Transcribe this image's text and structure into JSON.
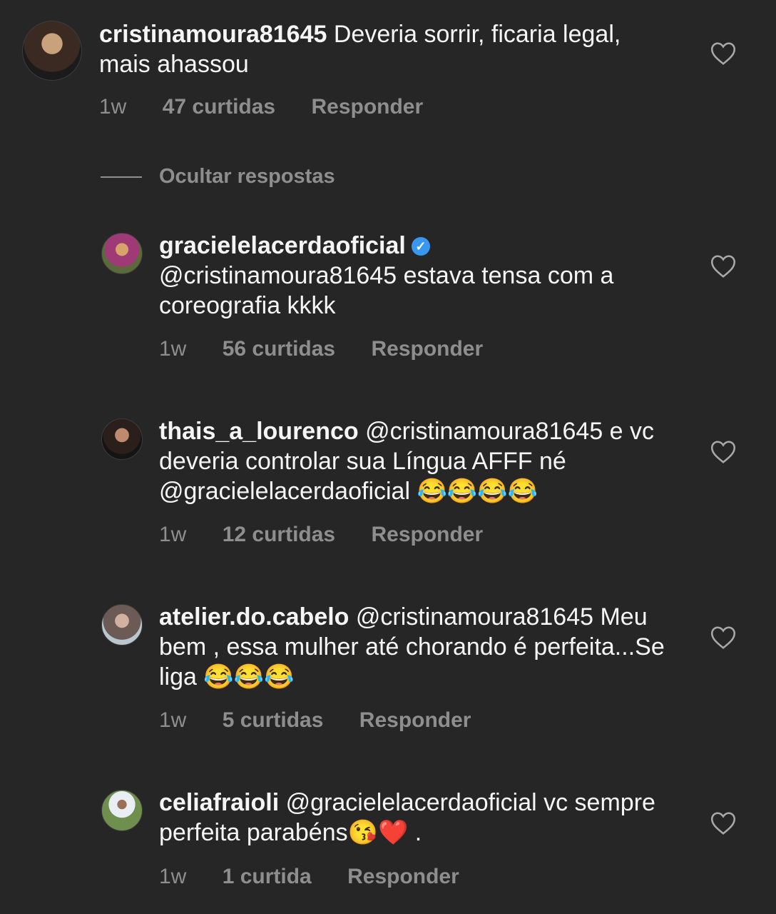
{
  "comment": {
    "username": "cristinamoura81645",
    "text": " Deveria sorrir, ficaria legal, mais ahassou",
    "time": "1w",
    "likes": "47 curtidas",
    "reply": "Responder"
  },
  "hide_replies_label": "Ocultar respostas",
  "replies": [
    {
      "username": "gracielelacerdaoficial",
      "verified": true,
      "text": "@cristinamoura81645 estava tensa com a coreografia kkkk",
      "time": "1w",
      "likes": "56 curtidas",
      "reply": "Responder"
    },
    {
      "username": "thais_a_lourenco",
      "text": " @cristinamoura81645 e vc deveria controlar sua Língua AFFF né @gracielelacerdaoficial 😂😂😂😂",
      "time": "1w",
      "likes": "12 curtidas",
      "reply": "Responder"
    },
    {
      "username": "atelier.do.cabelo",
      "text": " @cristinamoura81645 Meu bem , essa mulher  até chorando  é perfeita...Se liga 😂😂😂",
      "time": "1w",
      "likes": "5 curtidas",
      "reply": "Responder"
    },
    {
      "username": "celiafraioli",
      "text": " @gracielelacerdaoficial vc sempre perfeita parabéns😘❤️ .",
      "time": "1w",
      "likes": "1 curtida",
      "reply": "Responder"
    }
  ],
  "colors": {
    "background": "#262626",
    "text": "#f5f5f5",
    "muted": "#8e8e8e",
    "verified": "#3897f0"
  }
}
